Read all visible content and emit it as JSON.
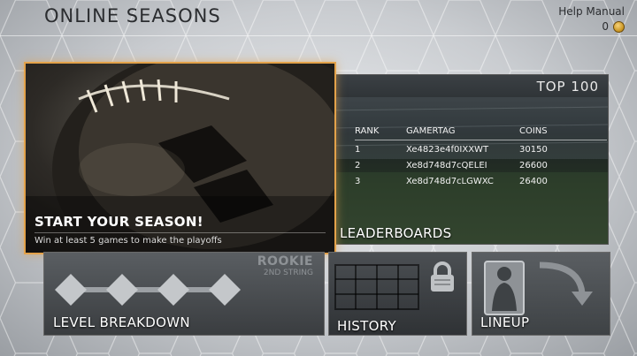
{
  "header": {
    "title": "ONLINE SEASONS",
    "help_label": "Help Manual",
    "coins_value": "0",
    "coin_icon": "coin-icon"
  },
  "featured": {
    "title": "START YOUR SEASON!",
    "subtitle": "Win at least 5 games to make the playoffs",
    "image": "football-closeup",
    "accent_color": "#e3a24a"
  },
  "leaderboards": {
    "title": "TOP 100",
    "label": "LEADERBOARDS",
    "columns": [
      "RANK",
      "GAMERTAG",
      "COINS"
    ],
    "rows": [
      {
        "rank": "1",
        "gamertag": "Xe4823e4f0IXXWT",
        "coins": "30150"
      },
      {
        "rank": "2",
        "gamertag": "Xe8d748d7cQELEI",
        "coins": "26600"
      },
      {
        "rank": "3",
        "gamertag": "Xe8d748d7cLGWXC",
        "coins": "26400"
      }
    ]
  },
  "level": {
    "label": "LEVEL BREAKDOWN",
    "rank_name": "ROOKIE",
    "rank_sub": "2ND STRING"
  },
  "history": {
    "label": "HISTORY",
    "icon": "lock-icon"
  },
  "lineup": {
    "label": "LINEUP",
    "icon": "player-card-icon"
  }
}
